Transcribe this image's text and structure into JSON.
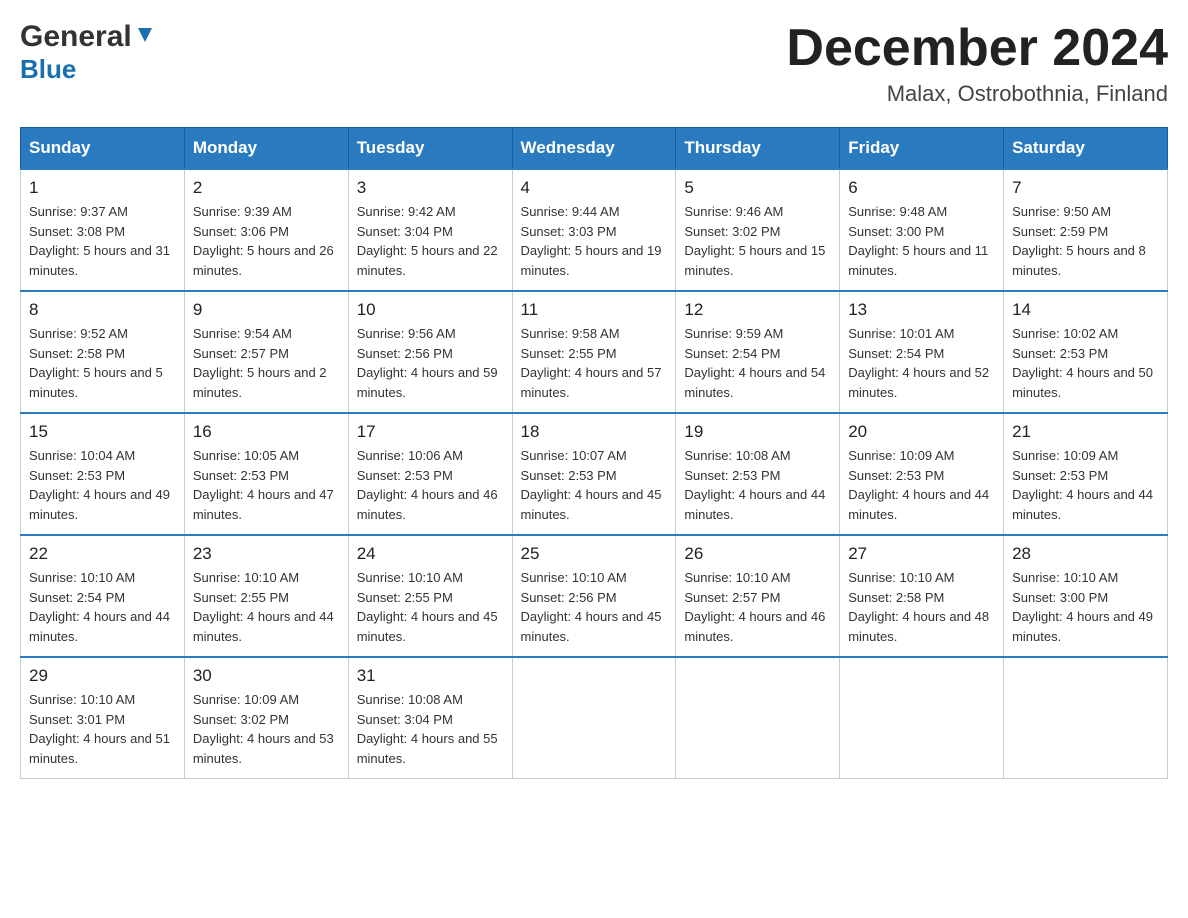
{
  "header": {
    "logo_general": "General",
    "logo_blue": "Blue",
    "month_title": "December 2024",
    "location": "Malax, Ostrobothnia, Finland"
  },
  "days_of_week": [
    "Sunday",
    "Monday",
    "Tuesday",
    "Wednesday",
    "Thursday",
    "Friday",
    "Saturday"
  ],
  "weeks": [
    [
      {
        "day": "1",
        "sunrise": "9:37 AM",
        "sunset": "3:08 PM",
        "daylight": "5 hours and 31 minutes."
      },
      {
        "day": "2",
        "sunrise": "9:39 AM",
        "sunset": "3:06 PM",
        "daylight": "5 hours and 26 minutes."
      },
      {
        "day": "3",
        "sunrise": "9:42 AM",
        "sunset": "3:04 PM",
        "daylight": "5 hours and 22 minutes."
      },
      {
        "day": "4",
        "sunrise": "9:44 AM",
        "sunset": "3:03 PM",
        "daylight": "5 hours and 19 minutes."
      },
      {
        "day": "5",
        "sunrise": "9:46 AM",
        "sunset": "3:02 PM",
        "daylight": "5 hours and 15 minutes."
      },
      {
        "day": "6",
        "sunrise": "9:48 AM",
        "sunset": "3:00 PM",
        "daylight": "5 hours and 11 minutes."
      },
      {
        "day": "7",
        "sunrise": "9:50 AM",
        "sunset": "2:59 PM",
        "daylight": "5 hours and 8 minutes."
      }
    ],
    [
      {
        "day": "8",
        "sunrise": "9:52 AM",
        "sunset": "2:58 PM",
        "daylight": "5 hours and 5 minutes."
      },
      {
        "day": "9",
        "sunrise": "9:54 AM",
        "sunset": "2:57 PM",
        "daylight": "5 hours and 2 minutes."
      },
      {
        "day": "10",
        "sunrise": "9:56 AM",
        "sunset": "2:56 PM",
        "daylight": "4 hours and 59 minutes."
      },
      {
        "day": "11",
        "sunrise": "9:58 AM",
        "sunset": "2:55 PM",
        "daylight": "4 hours and 57 minutes."
      },
      {
        "day": "12",
        "sunrise": "9:59 AM",
        "sunset": "2:54 PM",
        "daylight": "4 hours and 54 minutes."
      },
      {
        "day": "13",
        "sunrise": "10:01 AM",
        "sunset": "2:54 PM",
        "daylight": "4 hours and 52 minutes."
      },
      {
        "day": "14",
        "sunrise": "10:02 AM",
        "sunset": "2:53 PM",
        "daylight": "4 hours and 50 minutes."
      }
    ],
    [
      {
        "day": "15",
        "sunrise": "10:04 AM",
        "sunset": "2:53 PM",
        "daylight": "4 hours and 49 minutes."
      },
      {
        "day": "16",
        "sunrise": "10:05 AM",
        "sunset": "2:53 PM",
        "daylight": "4 hours and 47 minutes."
      },
      {
        "day": "17",
        "sunrise": "10:06 AM",
        "sunset": "2:53 PM",
        "daylight": "4 hours and 46 minutes."
      },
      {
        "day": "18",
        "sunrise": "10:07 AM",
        "sunset": "2:53 PM",
        "daylight": "4 hours and 45 minutes."
      },
      {
        "day": "19",
        "sunrise": "10:08 AM",
        "sunset": "2:53 PM",
        "daylight": "4 hours and 44 minutes."
      },
      {
        "day": "20",
        "sunrise": "10:09 AM",
        "sunset": "2:53 PM",
        "daylight": "4 hours and 44 minutes."
      },
      {
        "day": "21",
        "sunrise": "10:09 AM",
        "sunset": "2:53 PM",
        "daylight": "4 hours and 44 minutes."
      }
    ],
    [
      {
        "day": "22",
        "sunrise": "10:10 AM",
        "sunset": "2:54 PM",
        "daylight": "4 hours and 44 minutes."
      },
      {
        "day": "23",
        "sunrise": "10:10 AM",
        "sunset": "2:55 PM",
        "daylight": "4 hours and 44 minutes."
      },
      {
        "day": "24",
        "sunrise": "10:10 AM",
        "sunset": "2:55 PM",
        "daylight": "4 hours and 45 minutes."
      },
      {
        "day": "25",
        "sunrise": "10:10 AM",
        "sunset": "2:56 PM",
        "daylight": "4 hours and 45 minutes."
      },
      {
        "day": "26",
        "sunrise": "10:10 AM",
        "sunset": "2:57 PM",
        "daylight": "4 hours and 46 minutes."
      },
      {
        "day": "27",
        "sunrise": "10:10 AM",
        "sunset": "2:58 PM",
        "daylight": "4 hours and 48 minutes."
      },
      {
        "day": "28",
        "sunrise": "10:10 AM",
        "sunset": "3:00 PM",
        "daylight": "4 hours and 49 minutes."
      }
    ],
    [
      {
        "day": "29",
        "sunrise": "10:10 AM",
        "sunset": "3:01 PM",
        "daylight": "4 hours and 51 minutes."
      },
      {
        "day": "30",
        "sunrise": "10:09 AM",
        "sunset": "3:02 PM",
        "daylight": "4 hours and 53 minutes."
      },
      {
        "day": "31",
        "sunrise": "10:08 AM",
        "sunset": "3:04 PM",
        "daylight": "4 hours and 55 minutes."
      },
      null,
      null,
      null,
      null
    ]
  ],
  "labels": {
    "sunrise": "Sunrise:",
    "sunset": "Sunset:",
    "daylight": "Daylight:"
  }
}
